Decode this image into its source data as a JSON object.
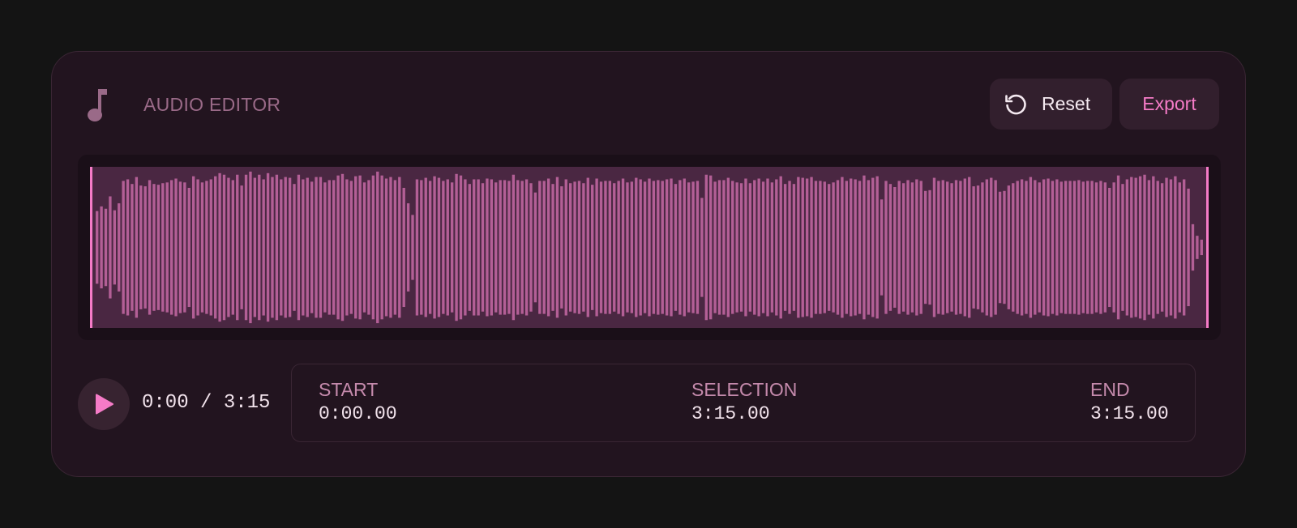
{
  "header": {
    "title": "AUDIO EDITOR",
    "icon": "music-note-icon",
    "reset_label": "Reset",
    "reset_icon": "reset-icon",
    "export_label": "Export"
  },
  "waveform": {
    "bar_count": 256,
    "amplitudes": [
      0.47,
      0.53,
      0.5,
      0.66,
      0.48,
      0.57,
      0.86,
      0.88,
      0.82,
      0.91,
      0.8,
      0.79,
      0.87,
      0.82,
      0.81,
      0.83,
      0.84,
      0.87,
      0.89,
      0.85,
      0.84,
      0.77,
      0.92,
      0.88,
      0.84,
      0.86,
      0.88,
      0.92,
      0.96,
      0.94,
      0.9,
      0.87,
      0.94,
      0.8,
      0.94,
      0.98,
      0.9,
      0.94,
      0.88,
      0.96,
      0.91,
      0.94,
      0.88,
      0.91,
      0.9,
      0.82,
      0.94,
      0.88,
      0.9,
      0.85,
      0.91,
      0.91,
      0.84,
      0.87,
      0.87,
      0.93,
      0.95,
      0.88,
      0.86,
      0.92,
      0.93,
      0.84,
      0.87,
      0.93,
      0.98,
      0.93,
      0.89,
      0.91,
      0.87,
      0.91,
      0.77,
      0.57,
      0.42,
      0.88,
      0.87,
      0.9,
      0.86,
      0.92,
      0.9,
      0.86,
      0.88,
      0.84,
      0.95,
      0.93,
      0.88,
      0.82,
      0.88,
      0.88,
      0.83,
      0.89,
      0.88,
      0.84,
      0.87,
      0.87,
      0.86,
      0.94,
      0.87,
      0.86,
      0.88,
      0.83,
      0.71,
      0.86,
      0.86,
      0.89,
      0.82,
      0.91,
      0.79,
      0.88,
      0.83,
      0.85,
      0.86,
      0.83,
      0.9,
      0.81,
      0.89,
      0.85,
      0.86,
      0.86,
      0.83,
      0.86,
      0.89,
      0.84,
      0.85,
      0.9,
      0.88,
      0.85,
      0.89,
      0.86,
      0.87,
      0.86,
      0.88,
      0.89,
      0.82,
      0.87,
      0.89,
      0.84,
      0.85,
      0.86,
      0.64,
      0.94,
      0.93,
      0.85,
      0.87,
      0.87,
      0.9,
      0.86,
      0.84,
      0.83,
      0.89,
      0.83,
      0.87,
      0.89,
      0.85,
      0.89,
      0.84,
      0.88,
      0.92,
      0.82,
      0.86,
      0.82,
      0.91,
      0.9,
      0.89,
      0.91,
      0.86,
      0.86,
      0.85,
      0.82,
      0.84,
      0.87,
      0.91,
      0.86,
      0.89,
      0.88,
      0.86,
      0.93,
      0.87,
      0.9,
      0.92,
      0.62,
      0.86,
      0.82,
      0.78,
      0.86,
      0.83,
      0.87,
      0.84,
      0.88,
      0.86,
      0.73,
      0.74,
      0.9,
      0.86,
      0.87,
      0.85,
      0.83,
      0.87,
      0.86,
      0.89,
      0.91,
      0.79,
      0.8,
      0.84,
      0.88,
      0.9,
      0.87,
      0.72,
      0.73,
      0.8,
      0.83,
      0.86,
      0.88,
      0.86,
      0.91,
      0.87,
      0.84,
      0.88,
      0.89,
      0.86,
      0.88,
      0.85,
      0.86,
      0.86,
      0.86,
      0.87,
      0.85,
      0.86,
      0.86,
      0.84,
      0.86,
      0.84,
      0.77,
      0.84,
      0.93,
      0.82,
      0.88,
      0.91,
      0.9,
      0.92,
      0.94,
      0.87,
      0.92,
      0.86,
      0.83,
      0.9,
      0.88,
      0.92,
      0.84,
      0.88,
      0.76,
      0.3,
      0.15,
      0.1
    ],
    "bar_color": "#b35f96",
    "background_color": "#4a2742",
    "handle_color": "#f57bc7"
  },
  "playback": {
    "time": "0:00 / 3:15",
    "play_icon": "play-icon"
  },
  "selection": {
    "start_label": "START",
    "start_value": "0:00.00",
    "selection_label": "SELECTION",
    "selection_value": "3:15.00",
    "end_label": "END",
    "end_value": "3:15.00"
  },
  "colors": {
    "accent": "#f57bc7",
    "card": "#22141f",
    "page": "#141414"
  }
}
